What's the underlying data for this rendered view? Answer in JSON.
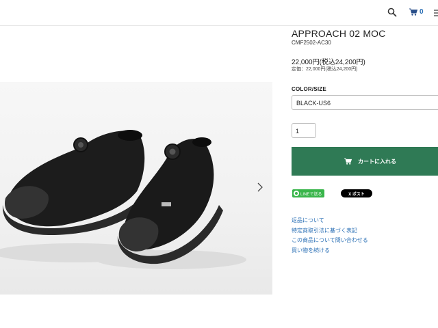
{
  "header": {
    "cart_count": "0"
  },
  "product": {
    "title": "APPROACH 02 MOC",
    "sku": "CMF2502-AC30",
    "price": "22,000円(税込24,200円)",
    "list_price": "定価：22,000円(税込24,200円)"
  },
  "options": {
    "label": "COLOR/SIZE",
    "selected": "BLACK-US6"
  },
  "quantity": "1",
  "cart_button_label": "カートに入れる",
  "share": {
    "line_label": "LINEで送る",
    "x_label": "X ポスト"
  },
  "links": [
    "返品について",
    "特定商取引法に基づく表記",
    "この商品について問い合わせる",
    "買い物を続ける"
  ],
  "colors": {
    "cart_button": "#2f7a55",
    "link": "#2a6fb5",
    "line_green": "#39b54a"
  },
  "icons": [
    "search-icon",
    "cart-icon",
    "menu-icon",
    "chevron-right-icon"
  ]
}
